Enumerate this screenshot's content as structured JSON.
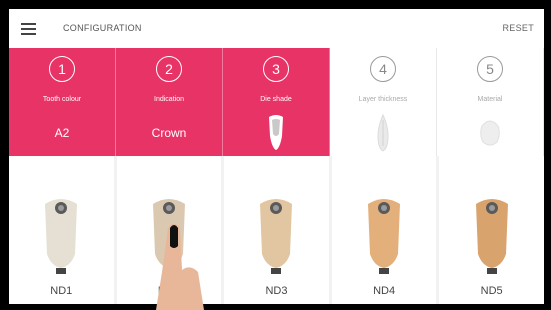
{
  "header": {
    "title": "CONFIGURATION",
    "reset_label": "RESET"
  },
  "icons": {
    "menu": "menu-icon"
  },
  "steps": [
    {
      "number": "1",
      "label": "Tooth colour",
      "value": "A2",
      "state": "active"
    },
    {
      "number": "2",
      "label": "Indication",
      "value": "Crown",
      "state": "active"
    },
    {
      "number": "3",
      "label": "Die shade",
      "value": "",
      "state": "active"
    },
    {
      "number": "4",
      "label": "Layer thickness",
      "value": "",
      "state": "inactive"
    },
    {
      "number": "5",
      "label": "Material",
      "value": "",
      "state": "inactive"
    }
  ],
  "shades": [
    {
      "label": "ND1",
      "color": "#e6dfd3"
    },
    {
      "label": "ND2",
      "color": "#dac9b0"
    },
    {
      "label": "ND3",
      "color": "#e1c6a1"
    },
    {
      "label": "ND4",
      "color": "#e3b07c"
    },
    {
      "label": "ND5",
      "color": "#d9a36e"
    }
  ],
  "colors": {
    "accent": "#e83366",
    "background": "#f2f2f2"
  }
}
